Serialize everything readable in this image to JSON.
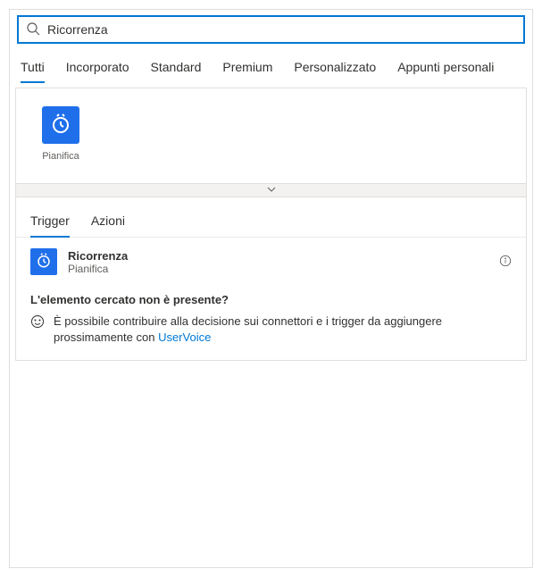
{
  "search": {
    "value": "Ricorrenza"
  },
  "tabs": {
    "all": "Tutti",
    "builtin": "Incorporato",
    "standard": "Standard",
    "premium": "Premium",
    "custom": "Personalizzato",
    "clipboard": "Appunti personali"
  },
  "connectors": [
    {
      "label": "Pianifica"
    }
  ],
  "subTabs": {
    "trigger": "Trigger",
    "actions": "Azioni"
  },
  "triggerItem": {
    "title": "Ricorrenza",
    "subtitle": "Pianifica"
  },
  "help": {
    "title": "L'elemento cercato non è presente?",
    "text": "È possibile contribuire alla decisione sui connettori e i trigger da aggiungere prossimamente con ",
    "link": "UserVoice"
  }
}
